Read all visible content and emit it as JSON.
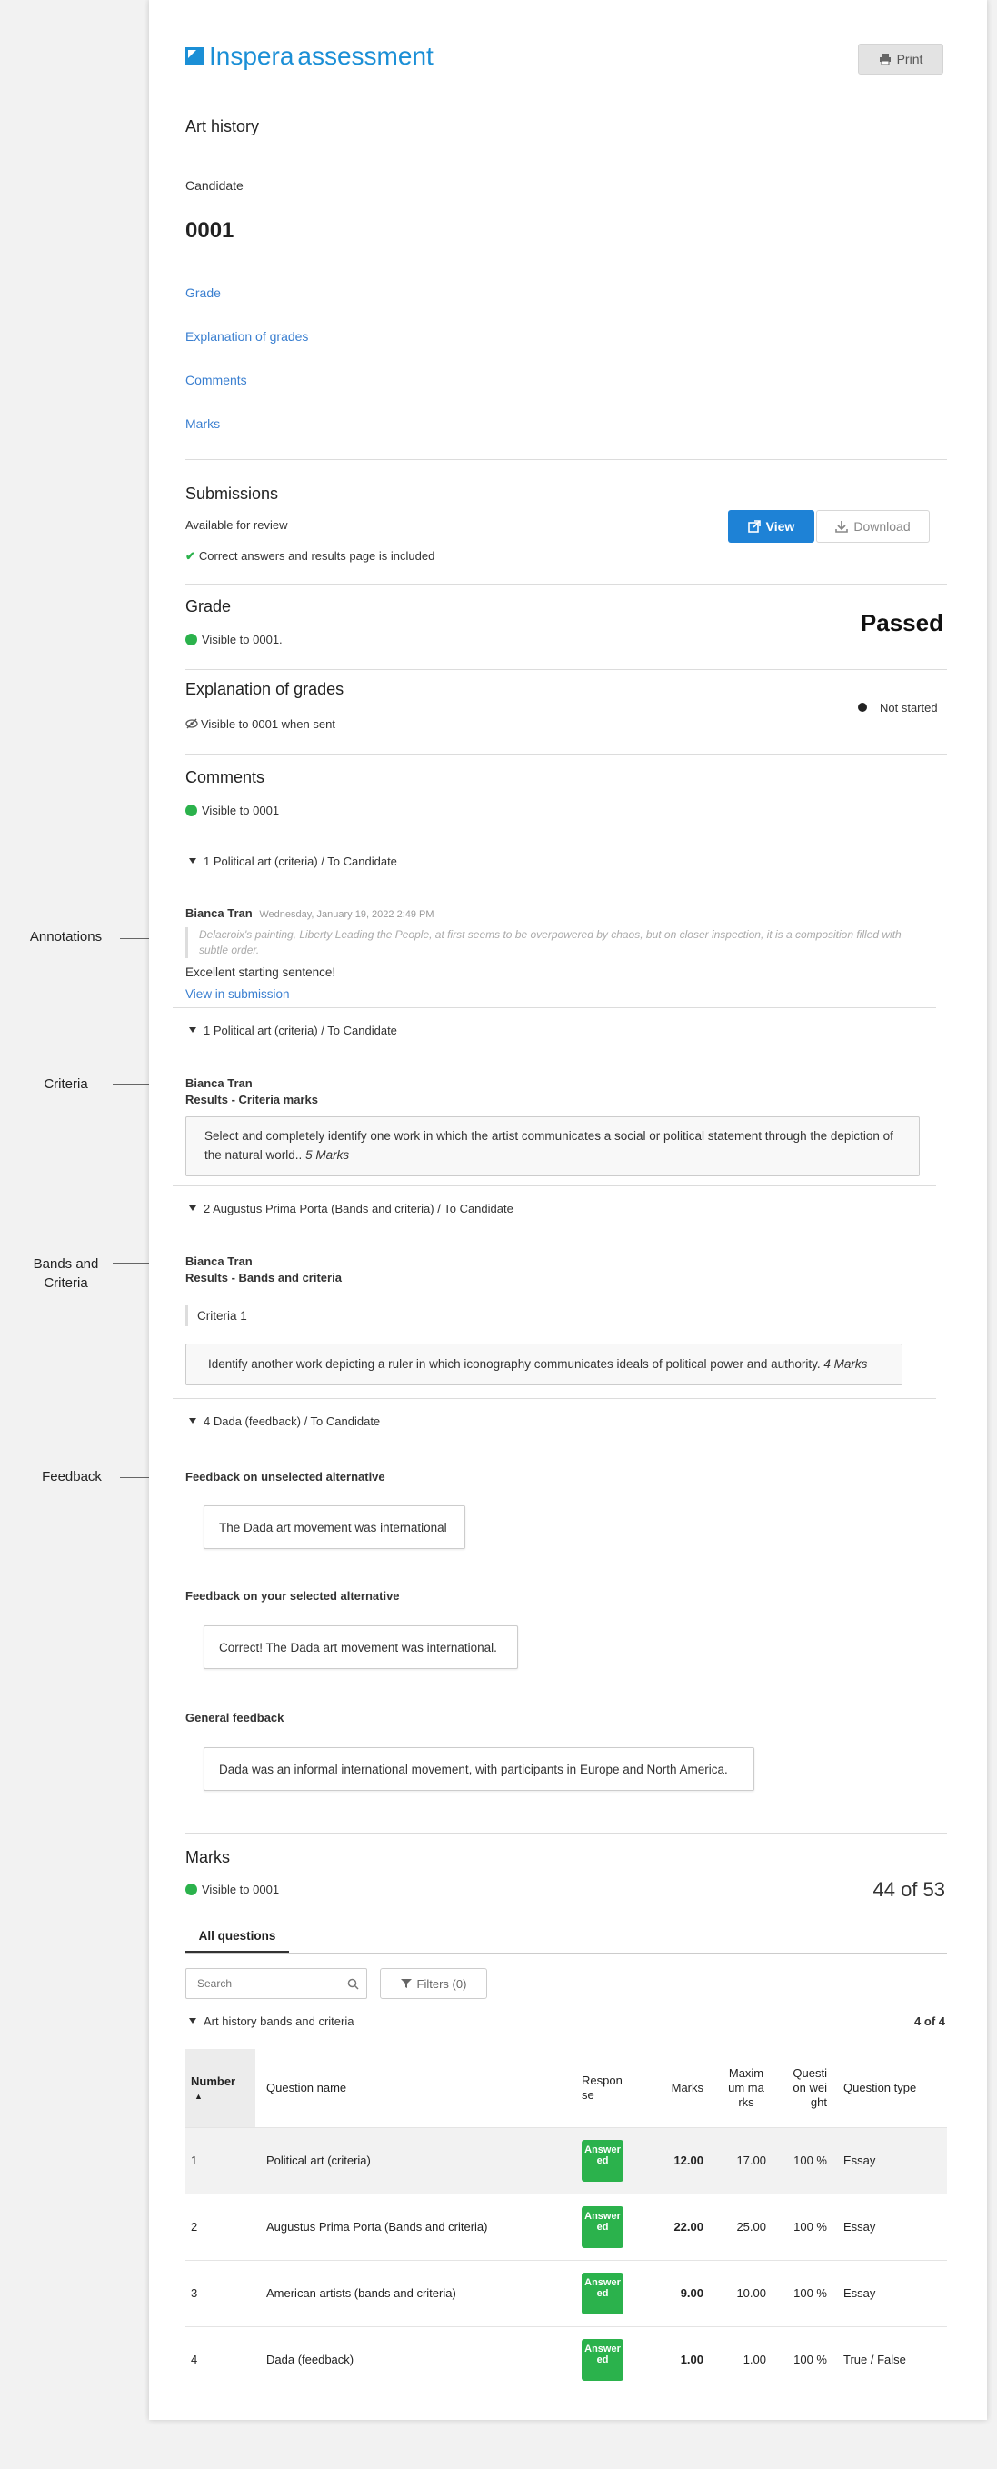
{
  "header": {
    "logo_brand": "Inspera",
    "logo_product": "assessment",
    "print_label": "Print"
  },
  "test": {
    "title": "Art history",
    "candidate_label": "Candidate",
    "candidate_id": "0001"
  },
  "nav_links": [
    "Grade",
    "Explanation of grades",
    "Comments",
    "Marks"
  ],
  "submissions": {
    "heading": "Submissions",
    "status": "Available for review",
    "included": "Correct answers and results page is included",
    "view_label": "View",
    "download_label": "Download"
  },
  "grade": {
    "heading": "Grade",
    "visibility": "Visible to 0001.",
    "value": "Passed"
  },
  "explanation": {
    "heading": "Explanation of grades",
    "visibility": "Visible to 0001 when sent",
    "status": "Not started"
  },
  "comments": {
    "heading": "Comments",
    "visibility": "Visible to 0001",
    "sections": [
      {
        "title": "1 Political art (criteria) / To Candidate",
        "author": "Bianca Tran",
        "timestamp": "Wednesday, January 19, 2022 2:49 PM",
        "quote": "Delacroix's painting, Liberty Leading the People, at first seems to be overpowered by chaos, but on closer inspection, it is a composition filled with subtle order.",
        "comment": "Excellent starting sentence!",
        "link": "View in submission"
      },
      {
        "title": "1 Political art (criteria) / To Candidate",
        "author": "Bianca Tran",
        "subtitle": "Results - Criteria marks",
        "text": "Select and completely identify one work in which the artist communicates a social or political statement through the depiction of the natural world..",
        "marks": "5 Marks"
      },
      {
        "title": "2 Augustus Prima Porta (Bands and criteria) / To Candidate",
        "author": "Bianca Tran",
        "subtitle": "Results - Bands and criteria",
        "criteria": "Criteria 1",
        "text": "Identify another work depicting a ruler in which iconography communicates ideals of political power and authority.",
        "marks": "4 Marks"
      },
      {
        "title": "4 Dada (feedback) / To Candidate",
        "unselected_label": "Feedback on unselected alternative",
        "unselected_text": "The Dada art movement was international",
        "selected_label": "Feedback on your selected alternative",
        "selected_text": "Correct! The Dada art movement was international.",
        "general_label": "General feedback",
        "general_text": "Dada was an informal international movement, with participants in Europe and North America."
      }
    ]
  },
  "margin_labels": {
    "annotations": "Annotations",
    "criteria": "Criteria",
    "bands_line1": "Bands and",
    "bands_line2": "Criteria",
    "feedback": "Feedback"
  },
  "marks": {
    "heading": "Marks",
    "visibility": "Visible to 0001",
    "total": "44 of 53",
    "tab_label": "All questions",
    "search_placeholder": "Search",
    "filters_label": "Filters (0)",
    "group_title": "Art history bands and criteria",
    "group_count": "4 of 4",
    "columns": [
      "Number",
      "Question name",
      "Response",
      "Marks",
      "Maximum marks",
      "Question weight",
      "Question type"
    ],
    "rows": [
      {
        "number": "1",
        "name": "Political art (criteria)",
        "response": "Answered",
        "marks": "12.00",
        "max": "17.00",
        "weight": "100 %",
        "type": "Essay"
      },
      {
        "number": "2",
        "name": "Augustus Prima Porta (Bands and criteria)",
        "response": "Answered",
        "marks": "22.00",
        "max": "25.00",
        "weight": "100 %",
        "type": "Essay"
      },
      {
        "number": "3",
        "name": "American artists (bands and criteria)",
        "response": "Answered",
        "marks": "9.00",
        "max": "10.00",
        "weight": "100 %",
        "type": "Essay"
      },
      {
        "number": "4",
        "name": "Dada (feedback)",
        "response": "Answered",
        "marks": "1.00",
        "max": "1.00",
        "weight": "100 %",
        "type": "True / False"
      }
    ]
  },
  "colors": {
    "brand": "#1b8fd6",
    "link": "#3a7fd0",
    "primary_button": "#1e82d6",
    "success": "#2bb24c"
  }
}
